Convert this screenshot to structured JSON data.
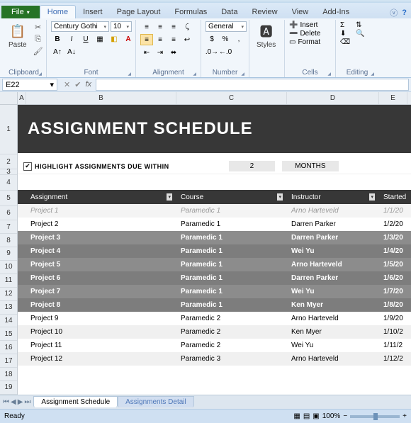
{
  "ribbon": {
    "tabs": [
      "File",
      "Home",
      "Insert",
      "Page Layout",
      "Formulas",
      "Data",
      "Review",
      "View",
      "Add-Ins"
    ],
    "activeTab": "Home",
    "groups": {
      "clipboard": "Clipboard",
      "font": "Font",
      "alignment": "Alignment",
      "number": "Number",
      "styles": "Styles",
      "cells": "Cells",
      "editing": "Editing"
    },
    "paste": "Paste",
    "fontName": "Century Gothi",
    "fontSize": "10",
    "numberFormat": "General",
    "insert": "Insert",
    "delete": "Delete",
    "format": "Format"
  },
  "namebox": "E22",
  "columns": [
    "A",
    "B",
    "C",
    "D",
    "E"
  ],
  "rows": [
    "1",
    "2",
    "3",
    "4",
    "5",
    "6",
    "7",
    "8",
    "9",
    "10",
    "11",
    "12",
    "13",
    "14",
    "15",
    "16",
    "17",
    "18",
    "19"
  ],
  "banner": "ASSIGNMENT SCHEDULE",
  "filter": {
    "checked": "✔",
    "label": "HIGHLIGHT ASSIGNMENTS DUE WITHIN",
    "value": "2",
    "unit": "MONTHS"
  },
  "headers": {
    "assignment": "Assignment",
    "course": "Course",
    "instructor": "Instructor",
    "started": "Started"
  },
  "data": [
    {
      "a": "Project 1",
      "c": "Paramedic 1",
      "i": "Arno Harteveld",
      "s": "1/1/20",
      "style": "muted"
    },
    {
      "a": "Project 2",
      "c": "Paramedic 1",
      "i": "Darren Parker",
      "s": "1/2/20",
      "style": ""
    },
    {
      "a": "Project 3",
      "c": "Paramedic 1",
      "i": "Darren Parker",
      "s": "1/3/20",
      "style": "hl"
    },
    {
      "a": "Project 4",
      "c": "Paramedic 1",
      "i": "Wei Yu",
      "s": "1/4/20",
      "style": "hl2"
    },
    {
      "a": "Project 5",
      "c": "Paramedic 1",
      "i": "Arno Harteveld",
      "s": "1/5/20",
      "style": "hl"
    },
    {
      "a": "Project 6",
      "c": "Paramedic 1",
      "i": "Darren Parker",
      "s": "1/6/20",
      "style": "hl2"
    },
    {
      "a": "Project 7",
      "c": "Paramedic 1",
      "i": "Wei Yu",
      "s": "1/7/20",
      "style": "hl"
    },
    {
      "a": "Project 8",
      "c": "Paramedic 1",
      "i": "Ken Myer",
      "s": "1/8/20",
      "style": "hl2"
    },
    {
      "a": "Project 9",
      "c": "Paramedic 2",
      "i": "Arno Harteveld",
      "s": "1/9/20",
      "style": ""
    },
    {
      "a": "Project 10",
      "c": "Paramedic 2",
      "i": "Ken Myer",
      "s": "1/10/2",
      "style": "alt"
    },
    {
      "a": "Project 11",
      "c": "Paramedic 2",
      "i": "Wei Yu",
      "s": "1/11/2",
      "style": ""
    },
    {
      "a": "Project 12",
      "c": "Paramedic 3",
      "i": "Arno Harteveld",
      "s": "1/12/2",
      "style": "alt"
    }
  ],
  "sheetTabs": {
    "active": "Assignment Schedule",
    "other": "Assignments Detail"
  },
  "status": {
    "ready": "Ready",
    "zoom": "100%"
  }
}
